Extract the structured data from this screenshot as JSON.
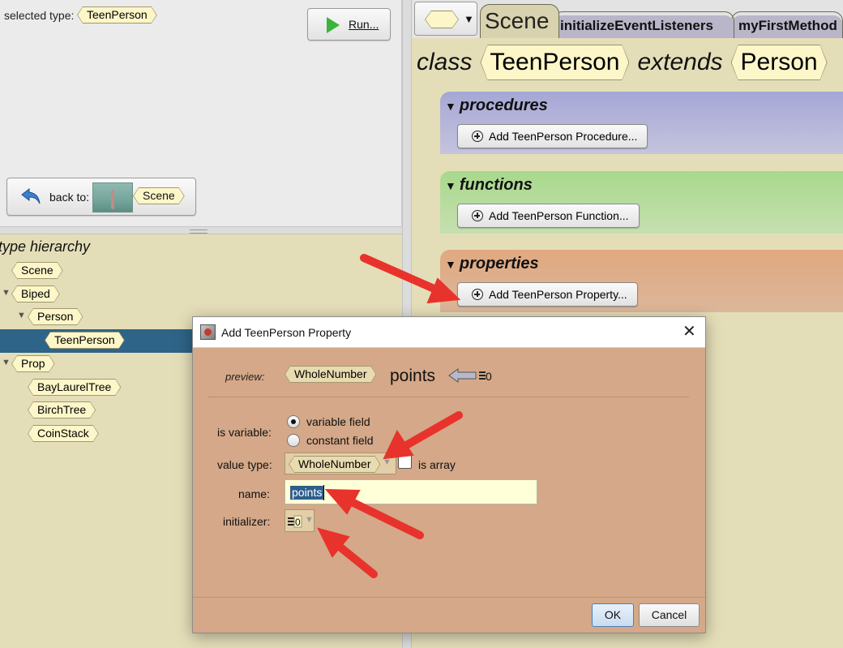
{
  "left_panel": {
    "selected_type_label": "selected type:",
    "selected_type": "TeenPerson",
    "run_button": "Run...",
    "back_label": "back to:",
    "back_scene": "Scene",
    "hierarchy_title": "type hierarchy",
    "hierarchy": [
      {
        "label": "Scene"
      },
      {
        "label": "Biped"
      },
      {
        "label": "Person"
      },
      {
        "label": "TeenPerson"
      },
      {
        "label": "Prop"
      },
      {
        "label": "BayLaurelTree"
      },
      {
        "label": "BirchTree"
      },
      {
        "label": "CoinStack"
      }
    ]
  },
  "editor": {
    "tabs": [
      {
        "label": "Scene"
      },
      {
        "label": "initializeEventListeners"
      },
      {
        "label": "myFirstMethod"
      }
    ],
    "class_kw": "class",
    "class_name": "TeenPerson",
    "extends_kw": "extends",
    "super_name": "Person",
    "sections": {
      "procedures": {
        "title": "procedures",
        "button": "Add TeenPerson Procedure..."
      },
      "functions": {
        "title": "functions",
        "button": "Add TeenPerson Function..."
      },
      "properties": {
        "title": "properties",
        "button": "Add TeenPerson Property..."
      }
    }
  },
  "dialog": {
    "title": "Add TeenPerson Property",
    "close": "✕",
    "preview_label": "preview:",
    "preview_type": "WholeNumber",
    "preview_name": "points",
    "is_variable_label": "is variable:",
    "option_variable": "variable field",
    "option_constant": "constant field",
    "value_type_label": "value type:",
    "value_type": "WholeNumber",
    "is_array_label": "is array",
    "name_label": "name:",
    "name_value": "points",
    "initializer_label": "initializer:",
    "initializer_value": "0",
    "ok": "OK",
    "cancel": "Cancel"
  },
  "colors": {
    "annotation_arrow": "#e8332d",
    "selection": "#2e6487",
    "dialog_body": "#d4a888"
  }
}
